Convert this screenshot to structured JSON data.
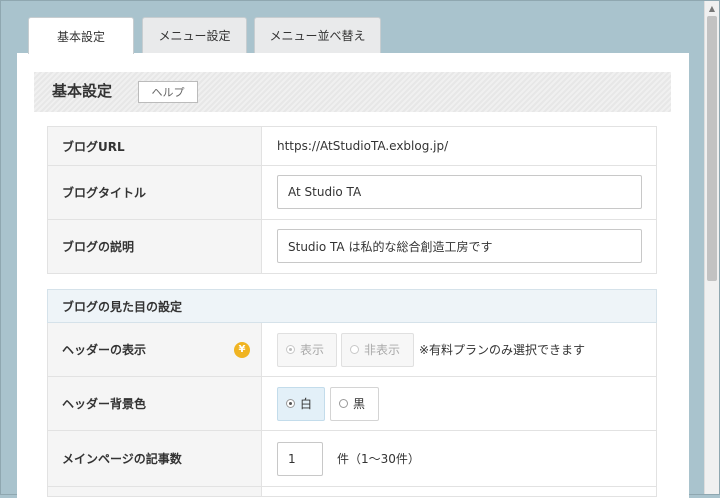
{
  "tabs": [
    {
      "label": "基本設定"
    },
    {
      "label": "メニュー設定"
    },
    {
      "label": "メニュー並べ替え"
    }
  ],
  "section": {
    "title": "基本設定",
    "help_label": "ヘルプ"
  },
  "blog_url": {
    "label": "ブログURL",
    "value": "https://AtStudioTA.exblog.jp/"
  },
  "blog_title": {
    "label": "ブログタイトル",
    "value": "At Studio TA"
  },
  "blog_desc": {
    "label": "ブログの説明",
    "value": "Studio TA は私的な総合創造工房です"
  },
  "appearance": {
    "heading": "ブログの見た目の設定"
  },
  "header_display": {
    "label": "ヘッダーの表示",
    "badge": "¥",
    "options": [
      "表示",
      "非表示"
    ],
    "selected": "表示",
    "note": "※有料プランのみ選択できます"
  },
  "header_bg": {
    "label": "ヘッダー背景色",
    "options": [
      "白",
      "黒"
    ],
    "selected": "白"
  },
  "posts_per_page": {
    "label": "メインページの記事数",
    "value": "1",
    "unit": "件（1〜30件）"
  },
  "colors": {
    "accent": "#e3f0f8",
    "background": "#a9c3cd",
    "badge": "#f0b422"
  },
  "icons": [
    "yen-coin-icon",
    "scroll-up-arrow-icon"
  ]
}
